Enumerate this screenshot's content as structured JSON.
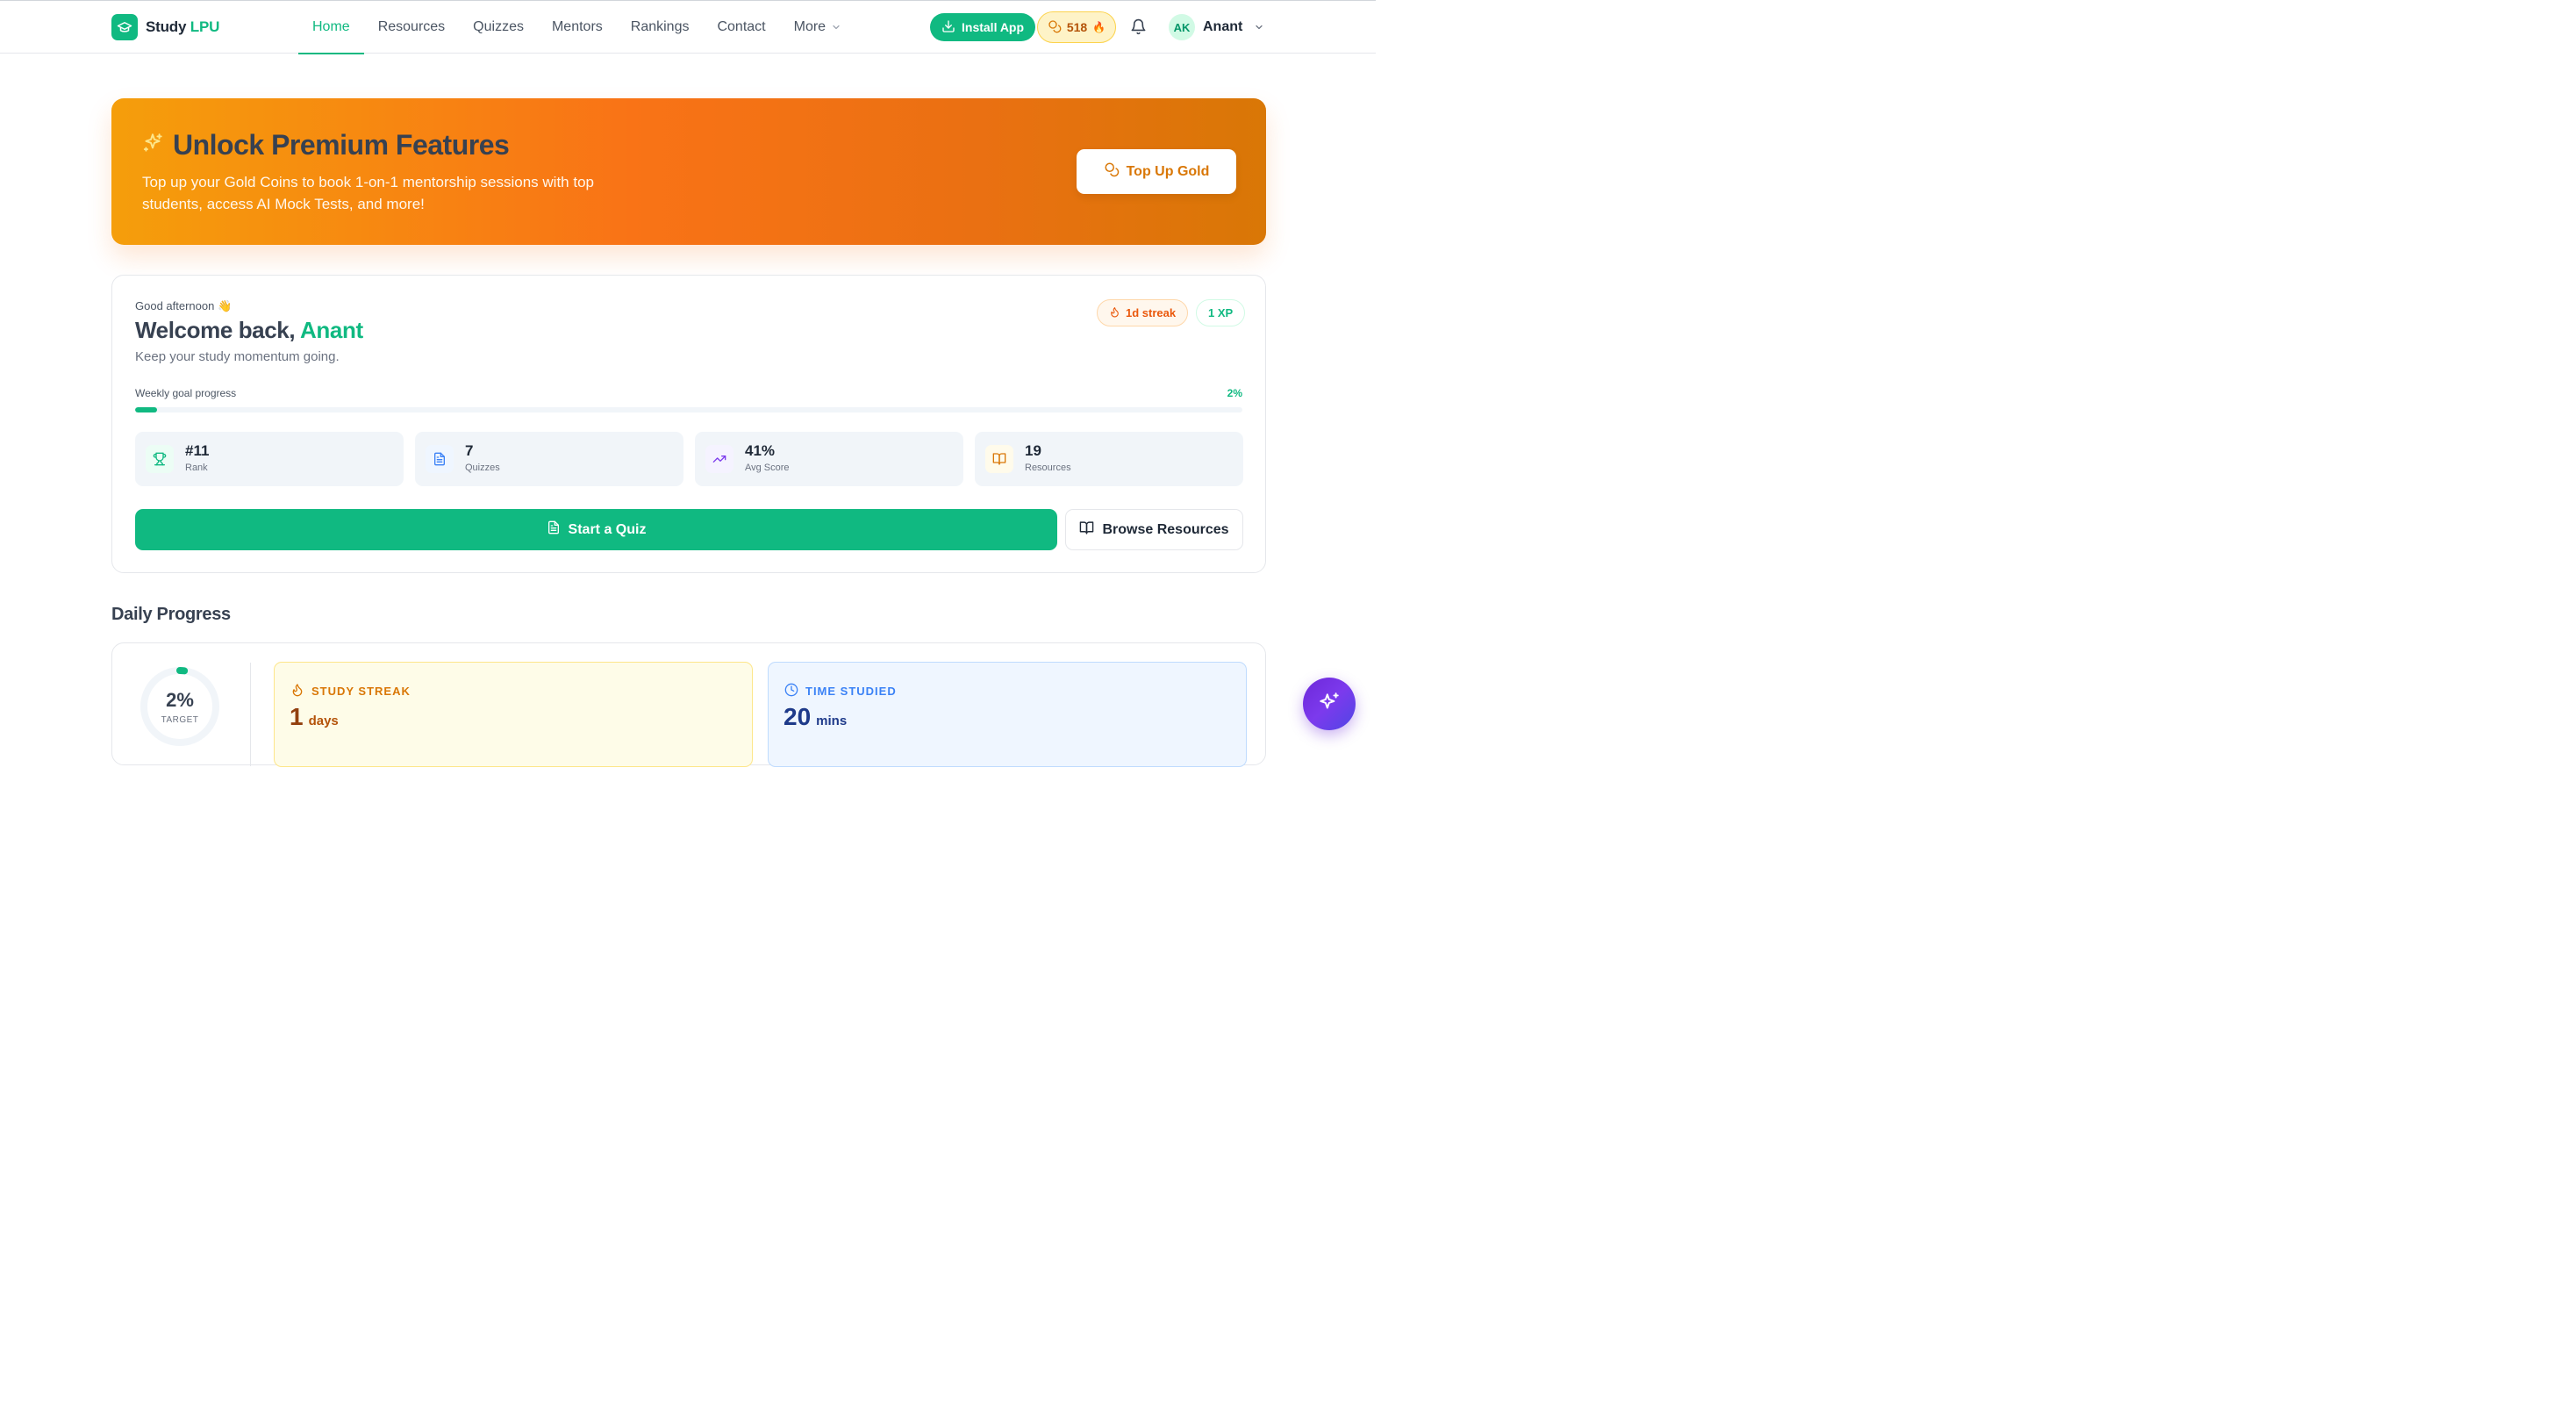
{
  "header": {
    "logo_part1": "Study",
    "logo_part2": "LPU",
    "nav": [
      {
        "label": "Home",
        "active": true
      },
      {
        "label": "Resources"
      },
      {
        "label": "Quizzes"
      },
      {
        "label": "Mentors"
      },
      {
        "label": "Rankings"
      },
      {
        "label": "Contact"
      },
      {
        "label": "More"
      }
    ],
    "install_label": "Install App",
    "coins": "518",
    "coins_emoji": "🔥",
    "avatar_initials": "AK",
    "user_name": "Anant"
  },
  "banner": {
    "title": "Unlock Premium Features",
    "description": "Top up your Gold Coins to book 1-on-1 mentorship sessions with top students, access AI Mock Tests, and more!",
    "button": "Top Up Gold"
  },
  "welcome": {
    "greeting": "Good afternoon 👋",
    "title_prefix": "Welcome back,",
    "name": "Anant",
    "subtitle": "Keep your study momentum going.",
    "streak_badge": "1d streak",
    "xp_badge": "1 XP",
    "goal_label": "Weekly goal progress",
    "goal_pct_text": "2%",
    "goal_progress": 0.02,
    "stats": [
      {
        "value": "#11",
        "label": "Rank",
        "icon": "trophy-icon"
      },
      {
        "value": "7",
        "label": "Quizzes",
        "icon": "document-icon"
      },
      {
        "value": "41%",
        "label": "Avg Score",
        "icon": "trending-up-icon"
      },
      {
        "value": "19",
        "label": "Resources",
        "icon": "book-open-icon"
      }
    ],
    "primary_button": "Start a Quiz",
    "secondary_button": "Browse Resources"
  },
  "daily": {
    "section_title": "Daily Progress",
    "ring_pct": "2%",
    "ring_label": "TARGET",
    "ring_progress": 0.02,
    "streak_title": "STUDY STREAK",
    "streak_value": "1",
    "streak_unit": "days",
    "time_title": "TIME STUDIED",
    "time_value": "20",
    "time_unit": "mins"
  },
  "colors": {
    "brand": "#10b981",
    "banner_orange": "#f97316",
    "gold": "#d97706",
    "fab_purple": "#6d28d9"
  }
}
